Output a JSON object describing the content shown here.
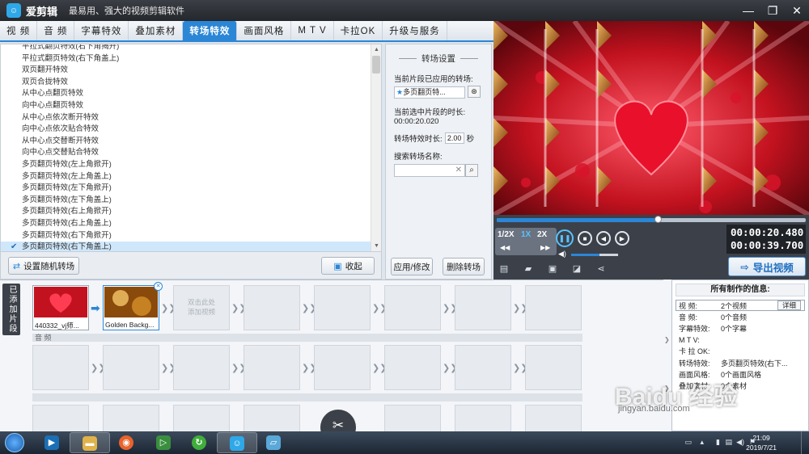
{
  "app": {
    "title": "爱剪辑",
    "slogan": "最易用、强大的视频剪辑软件"
  },
  "tabs": [
    {
      "label": "视 频"
    },
    {
      "label": "音 频"
    },
    {
      "label": "字幕特效"
    },
    {
      "label": "叠加素材"
    },
    {
      "label": "转场特效",
      "active": true
    },
    {
      "label": "画面风格"
    },
    {
      "label": "M T V"
    },
    {
      "label": "卡拉OK"
    },
    {
      "label": "升级与服务"
    }
  ],
  "transition_list": [
    "平拉式翻页特效(右下角揭开)",
    "平拉式翻页特效(右下角盖上)",
    "双页翻开特效",
    "双页合拢特效",
    "从中心点翻页特效",
    "向中心点翻页特效",
    "从中心点依次断开特效",
    "向中心点依次贴合特效",
    "从中心点交替断开特效",
    "向中心点交替贴合特效",
    "多页翻页特效(左上角掀开)",
    "多页翻页特效(左上角盖上)",
    "多页翻页特效(左下角掀开)",
    "多页翻页特效(左下角盖上)",
    "多页翻页特效(右上角掀开)",
    "多页翻页特效(右上角盖上)",
    "多页翻页特效(右下角掀开)",
    "多页翻页特效(右下角盖上)"
  ],
  "list_buttons": {
    "random": "设置随机转场",
    "favorite": "收起"
  },
  "settings": {
    "title": "转场设置",
    "applied_label": "当前片段已应用的转场:",
    "applied_value": "多页翻页特...",
    "clip_duration_label": "当前选中片段的时长:",
    "clip_duration_value": "00:00:20.020",
    "effect_duration_label": "转场特效时长:",
    "effect_duration_value": "2.00",
    "effect_duration_unit": "秒",
    "search_label": "搜索转场名称:",
    "search_value": "",
    "apply_button": "应用/修改",
    "delete_button": "删除转场"
  },
  "player": {
    "speeds": [
      "1/2X",
      "1X",
      "2X"
    ],
    "active_speed": "1X",
    "current_time": "00:00:20.480",
    "total_time": "00:00:39.700",
    "progress_fraction": 0.52,
    "volume_fraction": 0.6,
    "export_button": "导出视频"
  },
  "timeline": {
    "side_tab": "已添加片段",
    "clips": [
      {
        "name": "440332_vj师..."
      },
      {
        "name": "Golden Backg..."
      }
    ],
    "empty_hint": "双击此处\n添加视频",
    "audio_label": "音 频"
  },
  "info_panel": {
    "title": "所有制作的信息:",
    "detail_button": "详细",
    "rows": [
      {
        "key": "视    频:",
        "value": "2个视频"
      },
      {
        "key": "音    频:",
        "value": "0个音频"
      },
      {
        "key": "字幕特效:",
        "value": "0个字幕"
      },
      {
        "key": "M  T  V:",
        "value": ""
      },
      {
        "key": "卡 拉 OK:",
        "value": ""
      },
      {
        "key": "转场特效:",
        "value": "多页翻页特效(右下..."
      },
      {
        "key": "画面风格:",
        "value": "0个画面风格"
      },
      {
        "key": "叠加素材:",
        "value": "0个素材"
      }
    ]
  },
  "taskbar": {
    "time": "21:09",
    "date": "2019/7/21"
  },
  "watermark": {
    "main": "Baidu 经验",
    "url": "jingyan.baidu.com"
  },
  "colors": {
    "accent": "#2b86d6",
    "titlebar": "#2b2e33",
    "preview_bg": "#8a0e18"
  }
}
